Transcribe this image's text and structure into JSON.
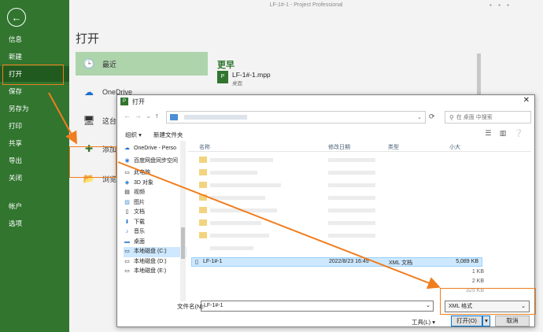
{
  "window_title": "LF-1#-1 - Project Professional",
  "sidebar": {
    "items": [
      {
        "label": "信息"
      },
      {
        "label": "新建"
      },
      {
        "label": "打开"
      },
      {
        "label": "保存"
      },
      {
        "label": "另存为"
      },
      {
        "label": "打印"
      },
      {
        "label": "共享"
      },
      {
        "label": "导出"
      },
      {
        "label": "关闭"
      },
      {
        "label": "帐户"
      },
      {
        "label": "选项"
      }
    ]
  },
  "main": {
    "title": "打开",
    "locations": [
      {
        "label": "最近"
      },
      {
        "label": "OneDrive"
      },
      {
        "label": "这台电"
      },
      {
        "label": "添加位"
      },
      {
        "label": "浏览"
      }
    ],
    "recent_header": "更早",
    "recent_file": {
      "name": "LF-1#-1.mpp",
      "location": "桌面"
    }
  },
  "dialog": {
    "title": "打开",
    "search_placeholder": "在 桌面 中搜索",
    "toolbar": {
      "organize": "组织 ▾",
      "new_folder": "新建文件夹"
    },
    "tree": [
      {
        "label": "OneDrive - Perso"
      },
      {
        "label": "百度网盘同步空间"
      },
      {
        "label": "此电脑"
      },
      {
        "label": "3D 对象"
      },
      {
        "label": "视频"
      },
      {
        "label": "图片"
      },
      {
        "label": "文档"
      },
      {
        "label": "下载"
      },
      {
        "label": "音乐"
      },
      {
        "label": "桌面"
      },
      {
        "label": "本地磁盘 (C:)"
      },
      {
        "label": "本地磁盘 (D:)"
      },
      {
        "label": "本地磁盘 (E:)"
      }
    ],
    "columns": {
      "name": "名称",
      "modified": "修改日期",
      "type": "类型",
      "size": "小大"
    },
    "selected_file": {
      "name": "LF-1#-1",
      "modified": "2022/8/23 16:45",
      "type": "XML 文档",
      "size": "5,089 KB"
    },
    "other_sizes": [
      "1 KB",
      "2 KB",
      "325 KB"
    ],
    "filename_label": "文件名(N):",
    "filename_value": "LF-1#-1",
    "filetype_value": "XML 格式",
    "tools_label": "工具(L) ▾",
    "open_label": "打开(O)",
    "cancel_label": "取消"
  },
  "colors": {
    "accent_green": "#31752f",
    "highlight": "#f07d1e"
  }
}
